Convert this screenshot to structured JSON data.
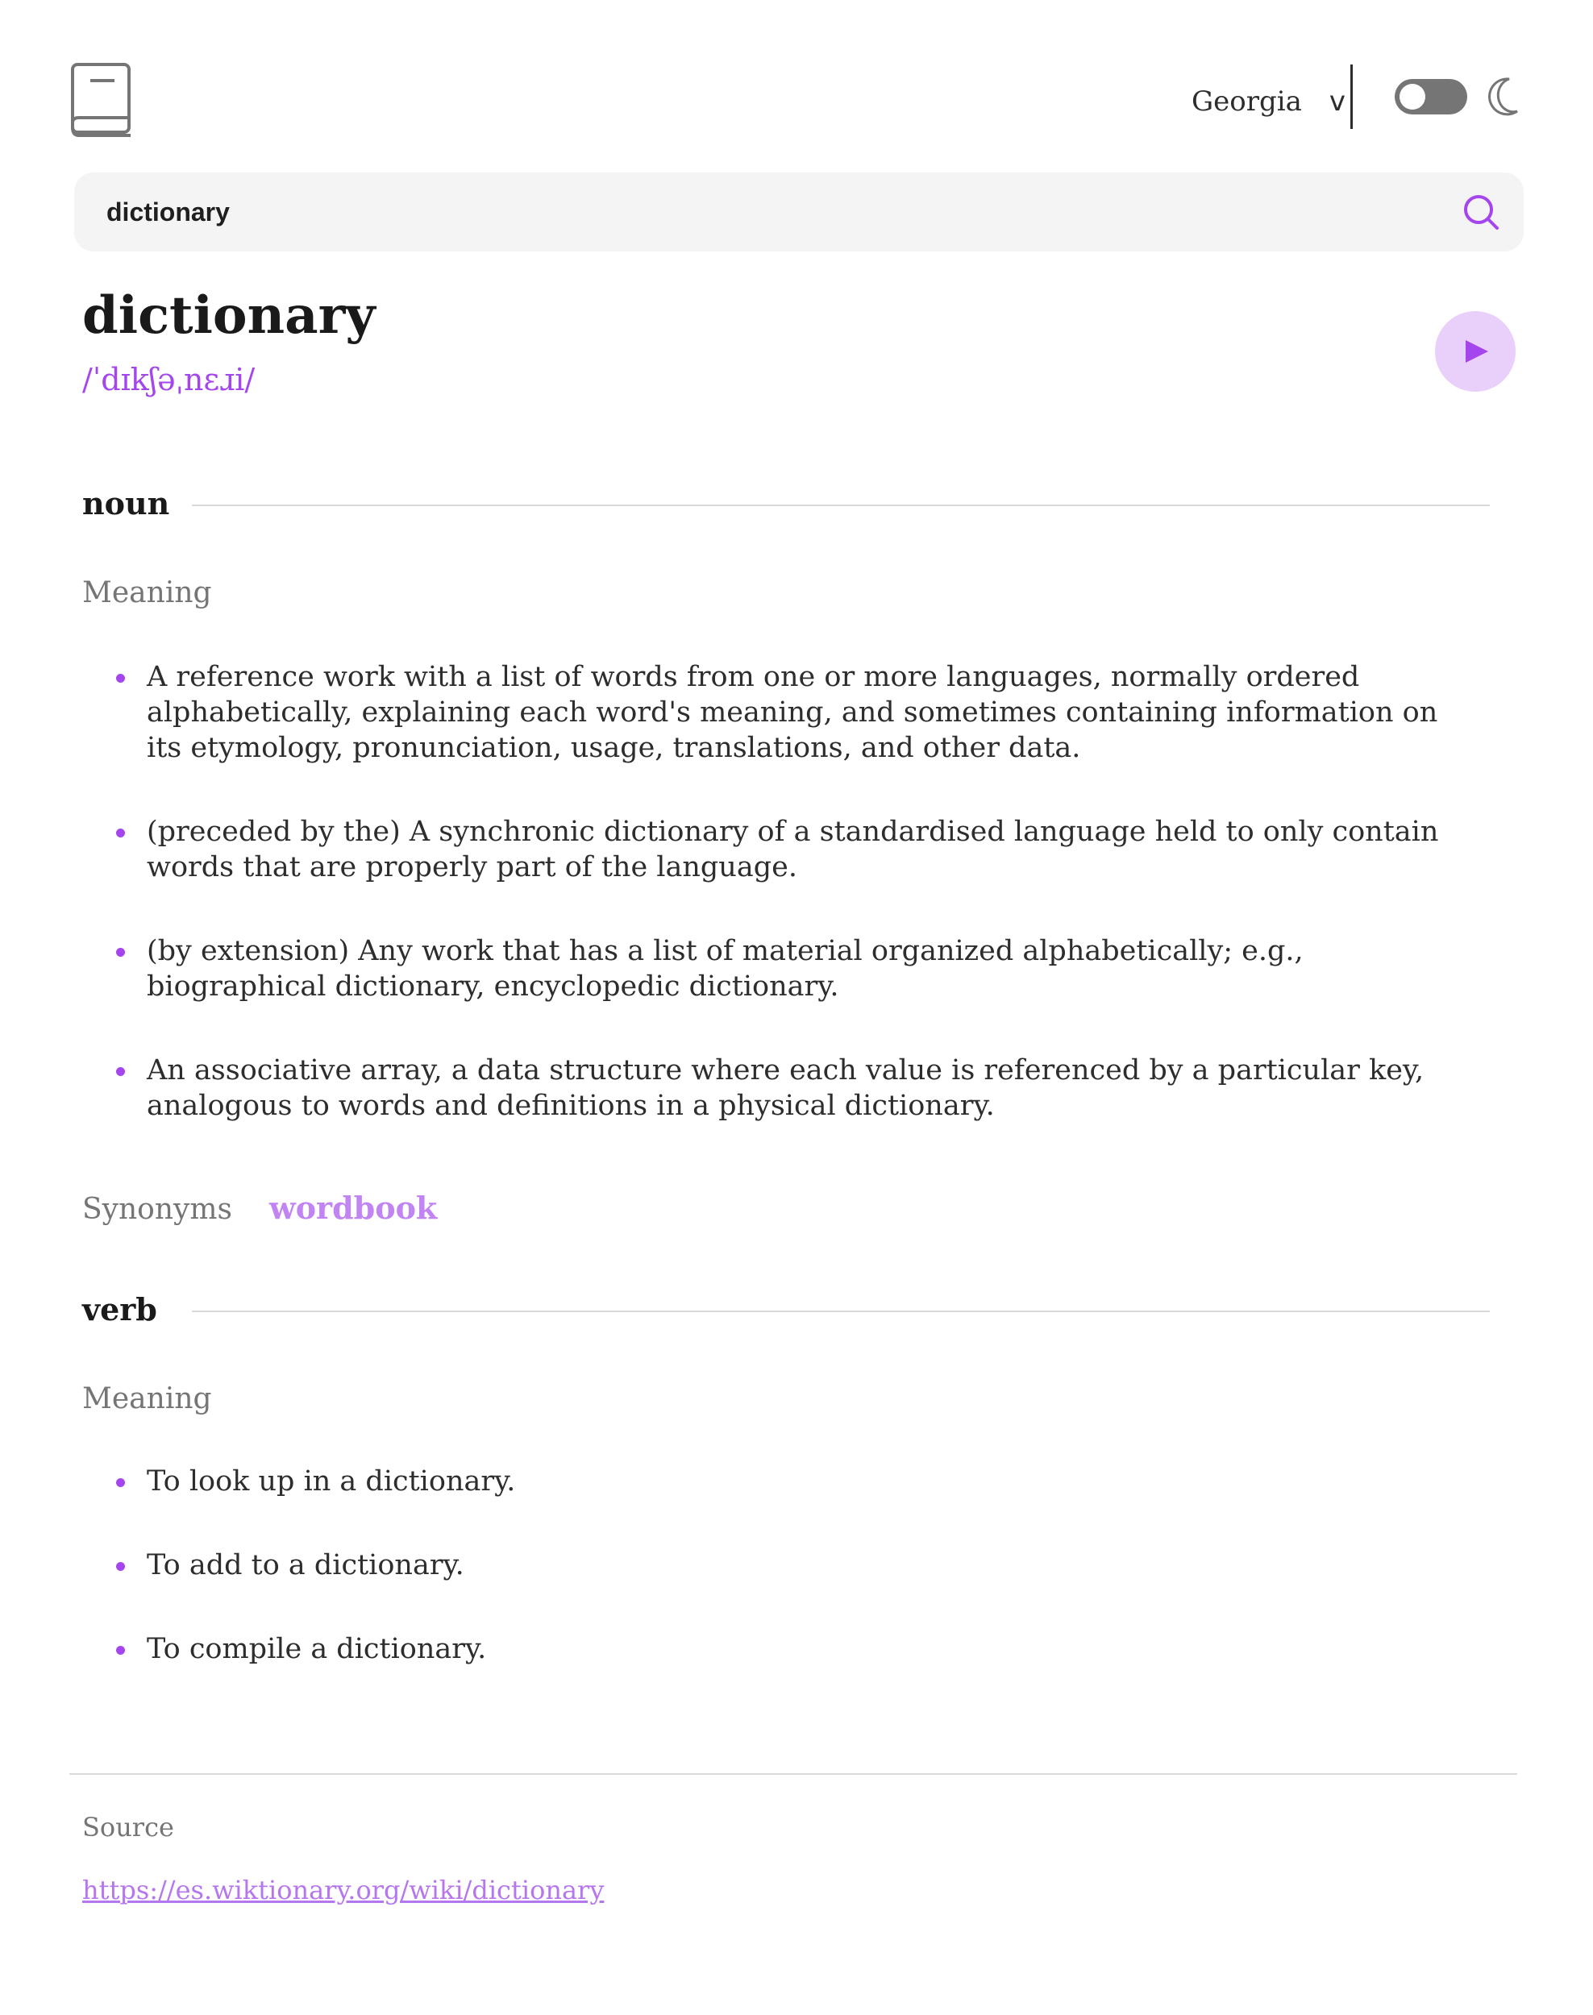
{
  "header": {
    "font_selected": "Georgia",
    "font_chevron": "v",
    "theme_dark": false,
    "icons": {
      "logo": "book-icon",
      "theme": "moon-icon"
    }
  },
  "search": {
    "value": "dictionary",
    "icon": "search-icon"
  },
  "entry": {
    "word": "dictionary",
    "phonetic": "/ˈdɪkʃəˌnɛɹi/",
    "play_icon": "play-icon"
  },
  "meanings": [
    {
      "part_of_speech": "noun",
      "meaning_label": "Meaning",
      "definitions": [
        "A reference work with a list of words from one or more languages, normally ordered alphabetically, explaining each word's meaning, and sometimes containing information on its etymology, pronunciation, usage, translations, and other data.",
        "(preceded by the) A synchronic dictionary of a standardised language held to only contain words that are properly part of the language.",
        "(by extension) Any work that has a list of material organized alphabetically; e.g., biographical dictionary, encyclopedic dictionary.",
        "An associative array, a data structure where each value is referenced by a particular key, analogous to words and definitions in a physical dictionary."
      ],
      "synonyms_label": "Synonyms",
      "synonyms": [
        "wordbook"
      ]
    },
    {
      "part_of_speech": "verb",
      "meaning_label": "Meaning",
      "definitions": [
        "To look up in a dictionary.",
        "To add to a dictionary.",
        "To compile a dictionary."
      ]
    }
  ],
  "footer": {
    "source_label": "Source",
    "source_url": "https://es.wiktionary.org/wiki/dictionary"
  },
  "colors": {
    "accent": "#a445ed",
    "accent_light": "#e9d0fa",
    "muted": "#757575",
    "divider": "#d9d9d9",
    "search_bg": "#f4f4f4"
  }
}
